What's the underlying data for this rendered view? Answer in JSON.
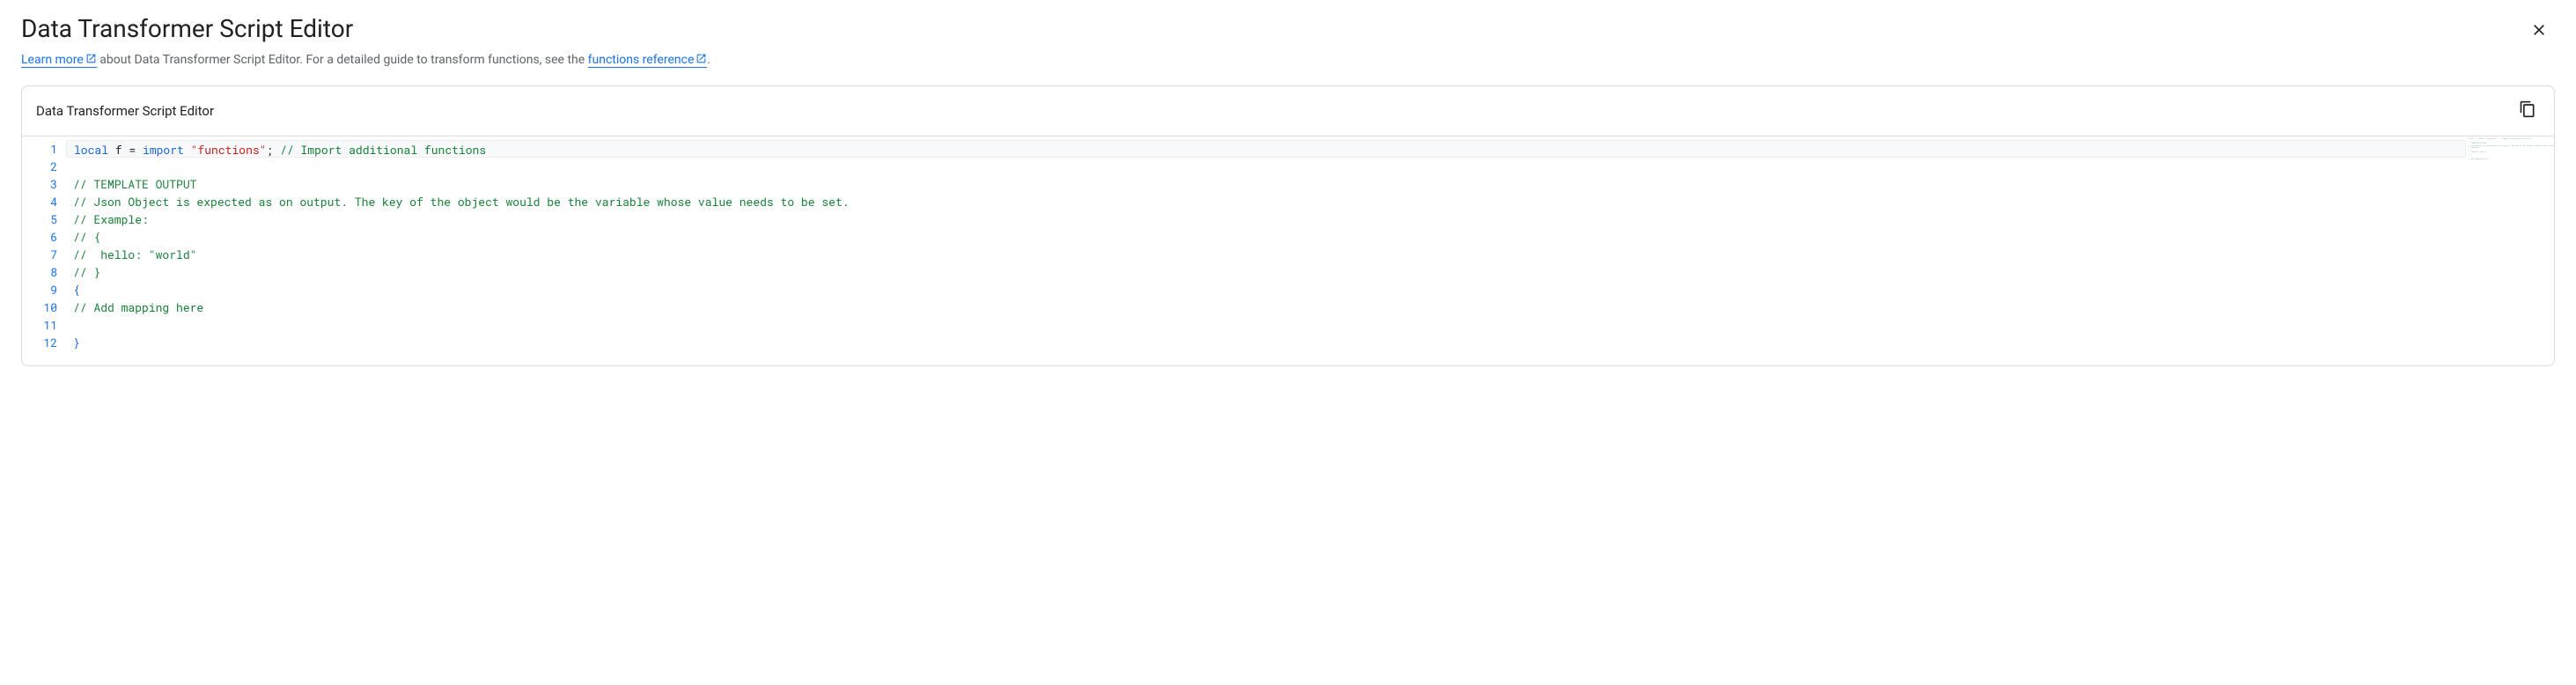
{
  "header": {
    "title": "Data Transformer Script Editor"
  },
  "subtitle": {
    "link1_text": "Learn more",
    "text_middle": " about Data Transformer Script Editor. For a detailed guide to transform functions, see the ",
    "link2_text": "functions reference",
    "text_end": "."
  },
  "editor": {
    "panel_title": "Data Transformer Script Editor",
    "lines": [
      {
        "num": 1,
        "highlighted": true,
        "tokens": [
          {
            "t": "local",
            "c": "keyword"
          },
          {
            "t": " f = ",
            "c": "default"
          },
          {
            "t": "import",
            "c": "keyword"
          },
          {
            "t": " ",
            "c": "default"
          },
          {
            "t": "\"functions\"",
            "c": "string"
          },
          {
            "t": "; ",
            "c": "default"
          },
          {
            "t": "// Import additional functions",
            "c": "comment"
          }
        ]
      },
      {
        "num": 2,
        "tokens": []
      },
      {
        "num": 3,
        "tokens": [
          {
            "t": "// TEMPLATE OUTPUT",
            "c": "comment"
          }
        ]
      },
      {
        "num": 4,
        "tokens": [
          {
            "t": "// Json Object is expected as on output. The key of the object would be the variable whose value needs to be set.",
            "c": "comment"
          }
        ]
      },
      {
        "num": 5,
        "tokens": [
          {
            "t": "// Example:",
            "c": "comment"
          }
        ]
      },
      {
        "num": 6,
        "tokens": [
          {
            "t": "// {",
            "c": "comment"
          }
        ]
      },
      {
        "num": 7,
        "tokens": [
          {
            "t": "//  hello: \"world\"",
            "c": "comment"
          }
        ]
      },
      {
        "num": 8,
        "tokens": [
          {
            "t": "// }",
            "c": "comment"
          }
        ]
      },
      {
        "num": 9,
        "tokens": [
          {
            "t": "{",
            "c": "brace"
          }
        ]
      },
      {
        "num": 10,
        "tokens": [
          {
            "t": "// Add mapping here",
            "c": "comment"
          }
        ]
      },
      {
        "num": 11,
        "tokens": []
      },
      {
        "num": 12,
        "tokens": [
          {
            "t": "}",
            "c": "brace"
          }
        ]
      }
    ]
  }
}
